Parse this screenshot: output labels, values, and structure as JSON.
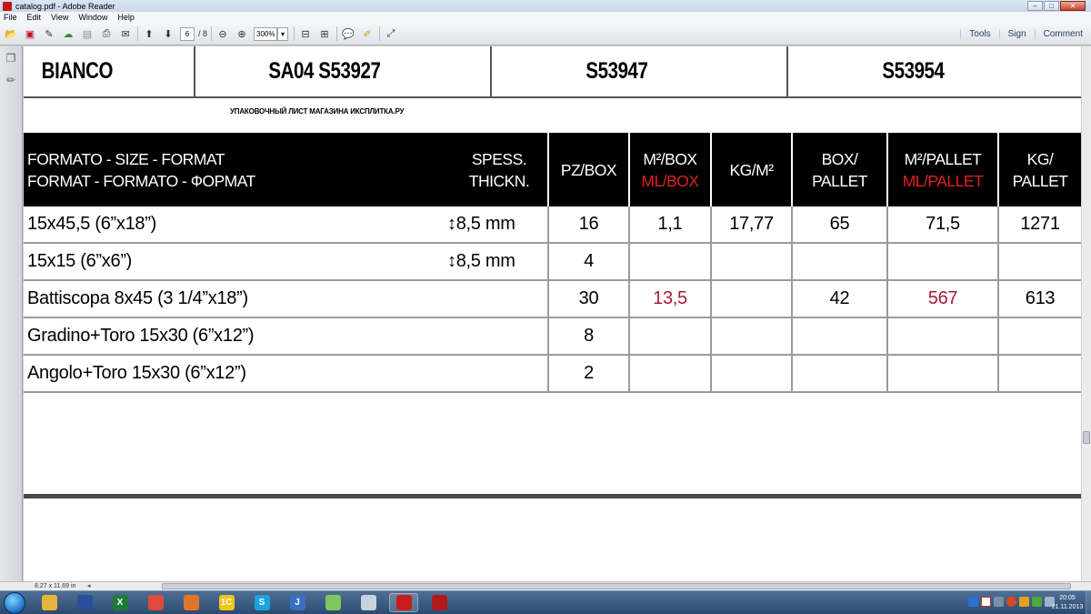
{
  "window": {
    "title": "catalog.pdf - Adobe Reader",
    "controls": [
      "–",
      "□",
      "✕"
    ]
  },
  "menu": [
    "File",
    "Edit",
    "View",
    "Window",
    "Help"
  ],
  "toolbar": {
    "page_current": "6",
    "page_total": "/ 8",
    "zoom": "300%",
    "right_links": [
      "Tools",
      "Sign",
      "Comment"
    ]
  },
  "document": {
    "header_cells": [
      "BIANCO",
      "SA04 S53927",
      "S53947",
      "S53954"
    ],
    "subtitle": "УПАКОВОЧНЫЙ ЛИСТ МАГАЗИНА ИКСПЛИТКА.РУ",
    "table": {
      "headers": [
        {
          "lines": [
            "FORMATO - SIZE - FORMAT",
            "FORMAT - FORMATO - ФОРМАТ"
          ],
          "red": ""
        },
        {
          "lines": [
            "SPESS.",
            "THICKN."
          ],
          "red": ""
        },
        {
          "lines": [
            "PZ/BOX"
          ],
          "red": ""
        },
        {
          "lines": [
            "M²/BOX"
          ],
          "red": "ML/BOX"
        },
        {
          "lines": [
            "KG/M²"
          ],
          "red": ""
        },
        {
          "lines": [
            "BOX/",
            "PALLET"
          ],
          "red": ""
        },
        {
          "lines": [
            "M²/PALLET"
          ],
          "red": "ML/PALLET"
        },
        {
          "lines": [
            "KG/",
            "PALLET"
          ],
          "red": ""
        }
      ],
      "rows": [
        {
          "format": "15x45,5 (6”x18”)",
          "thickness": "↕8,5 mm",
          "pz_box": "16",
          "m2_box": "1,1",
          "m2_box_red": false,
          "kg_m2": "17,77",
          "box_pallet": "65",
          "m2_pallet": "71,5",
          "m2_pallet_red": false,
          "kg_pallet": "1271"
        },
        {
          "format": "15x15 (6”x6”)",
          "thickness": "↕8,5 mm",
          "pz_box": "4",
          "m2_box": "",
          "m2_box_red": false,
          "kg_m2": "",
          "box_pallet": "",
          "m2_pallet": "",
          "m2_pallet_red": false,
          "kg_pallet": ""
        },
        {
          "format": "Battiscopa 8x45 (3 1/4”x18”)",
          "thickness": "",
          "pz_box": "30",
          "m2_box": "13,5",
          "m2_box_red": true,
          "kg_m2": "",
          "box_pallet": "42",
          "m2_pallet": "567",
          "m2_pallet_red": true,
          "kg_pallet": "613"
        },
        {
          "format": "Gradino+Toro  15x30 (6”x12”)",
          "thickness": "",
          "pz_box": "8",
          "m2_box": "",
          "m2_box_red": false,
          "kg_m2": "",
          "box_pallet": "",
          "m2_pallet": "",
          "m2_pallet_red": false,
          "kg_pallet": ""
        },
        {
          "format": "Angolo+Toro  15x30 (6”x12”)",
          "thickness": "",
          "pz_box": "2",
          "m2_box": "",
          "m2_box_red": false,
          "kg_m2": "",
          "box_pallet": "",
          "m2_pallet": "",
          "m2_pallet_red": false,
          "kg_pallet": ""
        }
      ]
    }
  },
  "status": {
    "page_size": "8,27 x 11,69 in"
  },
  "taskbar": {
    "apps": [
      {
        "name": "explorer",
        "label": "",
        "color": "#e5b53b"
      },
      {
        "name": "save",
        "label": "",
        "color": "#2a4f9a"
      },
      {
        "name": "excel",
        "label": "X",
        "color": "#1f7a3a"
      },
      {
        "name": "chrome",
        "label": "",
        "color": "#e04a3a"
      },
      {
        "name": "firefox",
        "label": "",
        "color": "#e0762a"
      },
      {
        "name": "1c",
        "label": "1C",
        "color": "#f2c416"
      },
      {
        "name": "skype",
        "label": "S",
        "color": "#1aa3e2"
      },
      {
        "name": "j-app",
        "label": "J",
        "color": "#3a6fbf"
      },
      {
        "name": "eraser",
        "label": "",
        "color": "#7bc95d"
      },
      {
        "name": "paint",
        "label": "",
        "color": "#c9d3de"
      },
      {
        "name": "acrobat",
        "label": "",
        "color": "#c71d1d"
      },
      {
        "name": "pdf-tool",
        "label": "",
        "color": "#b01a1a"
      }
    ],
    "clock_time": "20:05",
    "clock_date": "21.11.2013"
  }
}
